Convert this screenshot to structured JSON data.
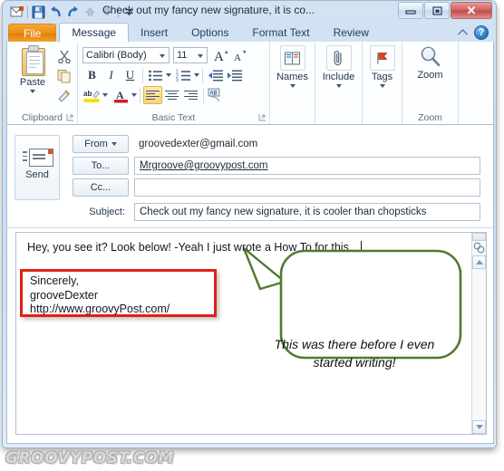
{
  "window": {
    "title": "Check out my fancy new signature, it is co...",
    "controls": {
      "minimize": "—",
      "restore": "❐",
      "close": "✕"
    }
  },
  "quick_access": {
    "items": [
      {
        "name": "app-envelope-icon",
        "label": "Outlook Message"
      },
      {
        "name": "save-icon",
        "label": "Save"
      },
      {
        "name": "undo-icon",
        "label": "Undo"
      },
      {
        "name": "redo-icon",
        "label": "Redo"
      },
      {
        "name": "previous-item-icon",
        "label": "Previous Item"
      },
      {
        "name": "next-item-icon",
        "label": "Next Item"
      },
      {
        "name": "customize-qat-icon",
        "label": "Customize Quick Access Toolbar"
      }
    ]
  },
  "ribbon": {
    "tabs": [
      {
        "label": "File",
        "active": false,
        "kind": "file"
      },
      {
        "label": "Message",
        "active": true,
        "kind": "normal"
      },
      {
        "label": "Insert",
        "active": false,
        "kind": "normal"
      },
      {
        "label": "Options",
        "active": false,
        "kind": "normal"
      },
      {
        "label": "Format Text",
        "active": false,
        "kind": "normal"
      },
      {
        "label": "Review",
        "active": false,
        "kind": "normal"
      }
    ],
    "help_label": "?",
    "collapse_label": "⌃",
    "groups": {
      "clipboard": {
        "label": "Clipboard",
        "paste_label": "Paste",
        "cut_label": "Cut",
        "copy_label": "Copy",
        "format_painter_label": "Format Painter",
        "dialog_launcher": "◪"
      },
      "basic_text": {
        "label": "Basic Text",
        "font_name": "Calibri (Body)",
        "font_size": "11",
        "bold_label": "B",
        "italic_label": "I",
        "underline_label": "U",
        "grow_font_label": "A",
        "shrink_font_label": "A",
        "highlight_label": "ab",
        "font_color_label": "A",
        "dialog_launcher": "◪"
      },
      "names": {
        "label": "Names",
        "icon": "address-book-icon"
      },
      "include": {
        "label": "Include",
        "icon": "paperclip-icon"
      },
      "tags": {
        "label": "Tags",
        "icon": "flag-icon"
      },
      "zoom": {
        "group_label": "Zoom",
        "label": "Zoom",
        "icon": "magnifier-icon"
      }
    }
  },
  "compose": {
    "send_label": "Send",
    "from_button": "From",
    "from_value": "groovedexter@gmail.com",
    "to_button": "To...",
    "to_value": "Mrgroove@groovypost.com",
    "cc_button": "Cc...",
    "cc_value": "",
    "subject_label": "Subject:",
    "subject_value": "Check out my fancy new signature, it is cooler than chopsticks",
    "body_line": "Hey, you see it?  Look below!  -Yeah I just wrote a How To for this…",
    "signature_lines": [
      "Sincerely,",
      "grooveDexter",
      "http://www.groovyPost.com/"
    ]
  },
  "annotations": {
    "highlight_color": "#e21f14",
    "callout_border_color": "#4f7a2f",
    "callout_text": "This was there before I even started writing!"
  },
  "watermark": "GROOVYPOST.COM"
}
